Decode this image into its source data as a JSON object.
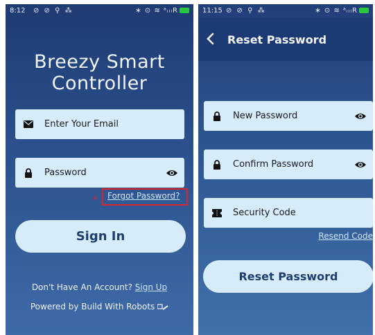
{
  "left_screen": {
    "status_bar": {
      "time": "8:12",
      "left_icons": "⊘ ⊘ ⚲ ⁂",
      "right_icons": "∗ ⊙ ≋ ᵃᵢₗₗR"
    },
    "app_title_line1": "Breezy Smart",
    "app_title_line2": "Controller",
    "email": {
      "placeholder": "Enter Your Email",
      "icon": "envelope-icon"
    },
    "password": {
      "placeholder": "Password",
      "icon": "lock-icon",
      "toggle_icon": "eye-icon"
    },
    "forgot_password_label": "Forgot Password?",
    "marker_number": "4",
    "sign_in_label": "Sign In",
    "no_account_text": "Don't Have An Account?",
    "sign_up_label": "Sign Up",
    "powered_by_text": "Powered by Build With Robots"
  },
  "right_screen": {
    "status_bar": {
      "time": "11:15",
      "left_icons": "⊘ ⊘ ⚲ ⁂",
      "right_icons": "∗ ⊙ ≋ ᵃᵢₗₗR"
    },
    "header_title": "Reset Password",
    "new_password": {
      "placeholder": "New Password",
      "icon": "lock-icon",
      "toggle_icon": "eye-icon"
    },
    "confirm_password": {
      "placeholder": "Confirm Password",
      "icon": "lock-icon",
      "toggle_icon": "eye-icon"
    },
    "security_code": {
      "placeholder": "Security Code",
      "icon": "ticket-icon"
    },
    "resend_code_label": "Resend Code",
    "reset_password_label": "Reset Password"
  },
  "colors": {
    "field_bg": "#d7ecfa",
    "button_text": "#1e3d70",
    "highlight_border": "#d8242b"
  }
}
